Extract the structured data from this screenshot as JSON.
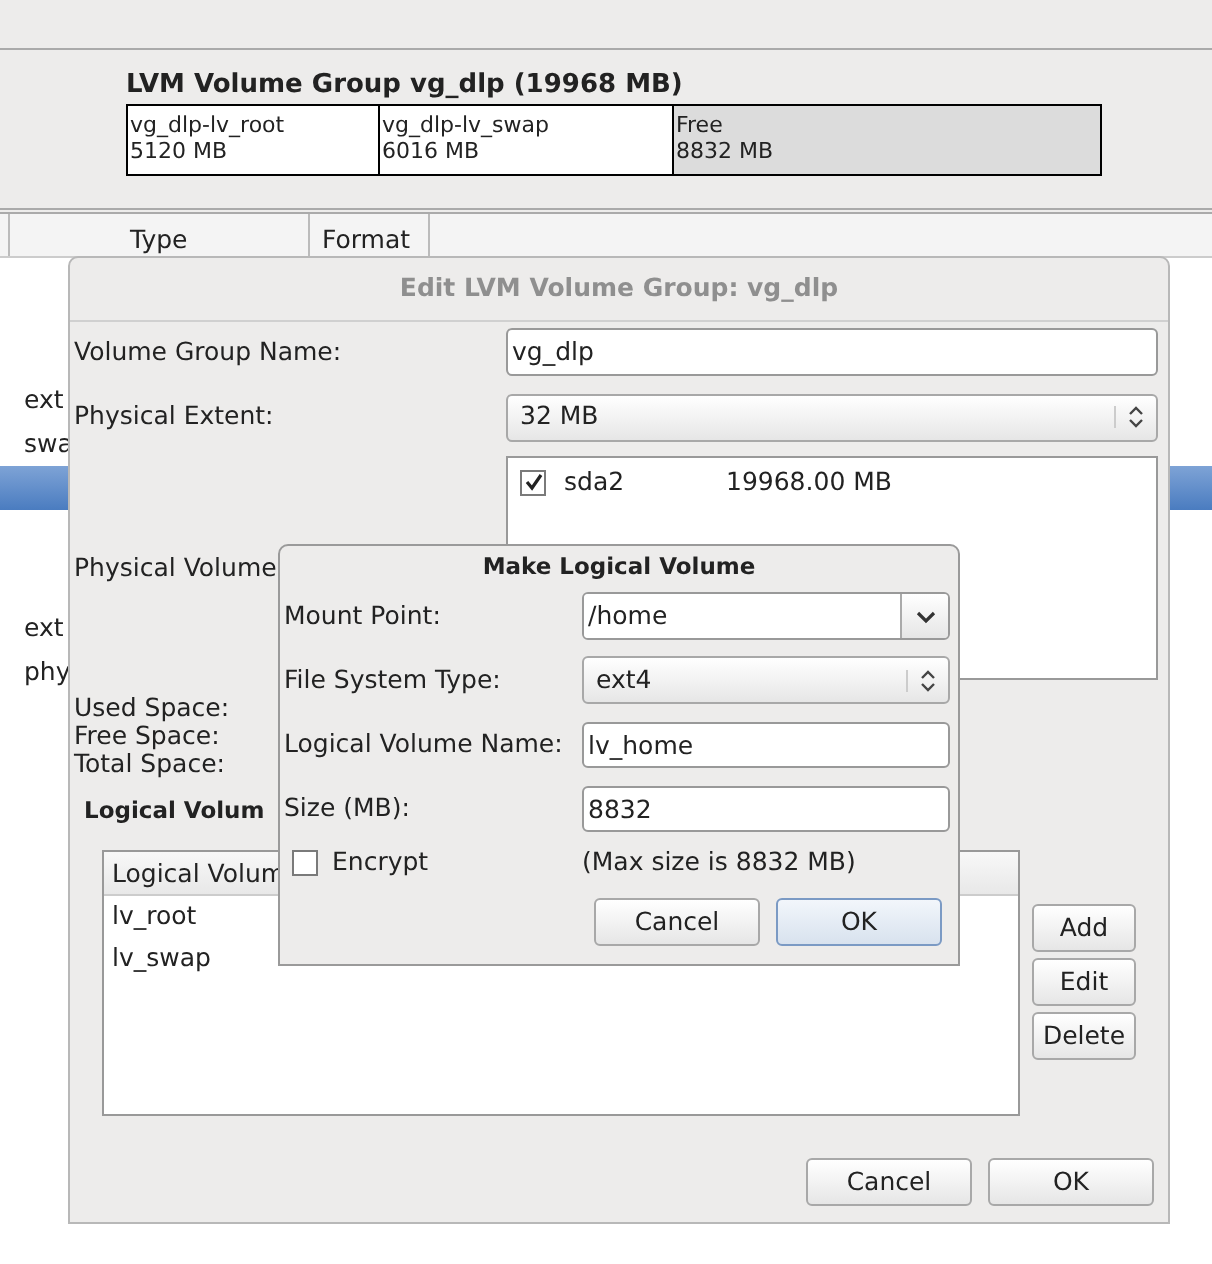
{
  "background": {
    "group_title": "LVM Volume Group vg_dlp (19968 MB)",
    "segments": [
      {
        "name": "vg_dlp-lv_root",
        "size": "5120 MB",
        "kind": "used"
      },
      {
        "name": "vg_dlp-lv_swap",
        "size": "6016 MB",
        "kind": "used"
      },
      {
        "name": "Free",
        "size": "8832 MB",
        "kind": "free"
      }
    ],
    "columns": [
      "Type",
      "Format"
    ],
    "rows": [
      {
        "cell": "ext",
        "selected": false
      },
      {
        "cell": "swa",
        "selected": false
      },
      {
        "selected": true
      },
      {
        "cell": "ext",
        "selected": false
      },
      {
        "cell": "phy",
        "selected": false
      }
    ]
  },
  "edit_dialog": {
    "title": "Edit LVM Volume Group: vg_dlp",
    "name_label": "Volume Group Name:",
    "name_value": "vg_dlp",
    "extent_label": "Physical Extent:",
    "extent_value": "32 MB",
    "pv_label": "Physical Volume",
    "pv_items": [
      {
        "name": "sda2",
        "size": "19968.00 MB",
        "checked": true
      }
    ],
    "space_labels": [
      "Used Space:",
      "Free Space:",
      "Total Space:"
    ],
    "lv_heading": "Logical Volum",
    "lv_column": "Logical Volum",
    "lv_rows": [
      {
        "name": "lv_root"
      },
      {
        "name": "lv_swap"
      }
    ],
    "side_buttons": [
      "Add",
      "Edit",
      "Delete"
    ],
    "buttons": [
      "Cancel",
      "OK"
    ]
  },
  "make_dialog": {
    "title": "Make Logical Volume",
    "fields": [
      {
        "kind": "combo",
        "label": "Mount Point:",
        "value": "/home"
      },
      {
        "kind": "select",
        "label": "File System Type:",
        "value": "ext4"
      },
      {
        "kind": "text",
        "label": "Logical Volume Name:",
        "value": "lv_home"
      },
      {
        "kind": "text",
        "label": "Size (MB):",
        "value": "8832"
      }
    ],
    "encrypt": {
      "label": "Encrypt",
      "checked": false
    },
    "hint": "(Max size is 8832 MB)",
    "buttons": [
      {
        "label": "Cancel",
        "default": false
      },
      {
        "label": "OK",
        "default": true
      }
    ]
  }
}
